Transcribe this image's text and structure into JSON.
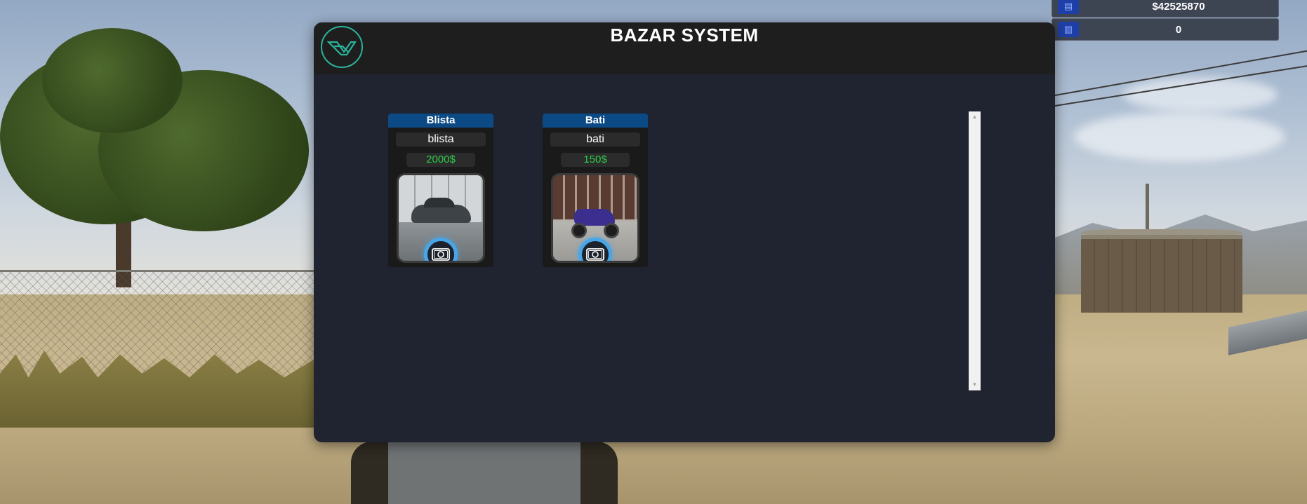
{
  "hud": {
    "money": "$42525870",
    "bank": "0",
    "money_icon": "wallet-icon",
    "bank_icon": "card-icon"
  },
  "window": {
    "title": "BAZAR SYSTEM",
    "logo_icon": "logo-icon"
  },
  "listings": [
    {
      "header": "Blista",
      "name": "blista",
      "price": "2000$",
      "image": "car-image",
      "buy_icon": "cash-icon"
    },
    {
      "header": "Bati",
      "name": "bati",
      "price": "150$",
      "image": "motorcycle-image",
      "buy_icon": "cash-icon"
    }
  ],
  "colors": {
    "card_header": "#0c4a85",
    "price_text": "#2ecc4a",
    "buy_ring": "#48a6e8",
    "logo_ring": "#2bb39a",
    "hud_icon": "#1f3fa8"
  }
}
